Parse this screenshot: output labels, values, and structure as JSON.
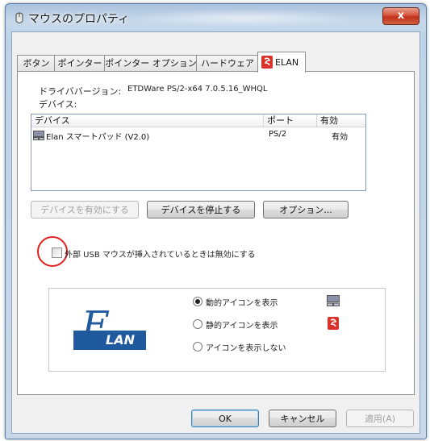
{
  "window": {
    "title": "マウスのプロパティ",
    "close_label": "x"
  },
  "tabs": [
    {
      "label": "ボタン"
    },
    {
      "label": "ポインター"
    },
    {
      "label": "ポインター オプション"
    },
    {
      "label": "ハードウェア"
    },
    {
      "label": "ELAN",
      "selected": true
    }
  ],
  "info": {
    "driver_version_label": "ドライババージョン:",
    "driver_version_value": "ETDWare PS/2-x64 7.0.5.16_WHQL",
    "device_label": "デバイス:"
  },
  "device_list": {
    "columns": [
      "デバイス",
      "ポート",
      "有効"
    ],
    "rows": [
      {
        "device": "Elan スマートパッド (V2.0)",
        "port": "PS/2",
        "enabled": "有効"
      }
    ]
  },
  "buttons": {
    "enable_device": "デバイスを有効にする",
    "disable_device": "デバイスを停止する",
    "options": "オプション...",
    "ok": "OK",
    "cancel": "キャンセル",
    "apply": "適用(A)"
  },
  "external_usb_checkbox": {
    "label": "外部 USB マウスが挿入されているときは無効にする",
    "checked": false
  },
  "tray_icon_options": [
    {
      "label": "動的アイコンを表示",
      "selected": true,
      "icon": "touchpad-icon"
    },
    {
      "label": "静的アイコンを表示",
      "selected": false,
      "icon": "elan-red-icon"
    },
    {
      "label": "アイコンを表示しない",
      "selected": false
    }
  ],
  "logo": {
    "text": "LAN",
    "letter": "E"
  },
  "colors": {
    "accent_red": "#d9322b",
    "logo_blue": "#1f5a9e",
    "highlight_circle": "#e02020"
  }
}
